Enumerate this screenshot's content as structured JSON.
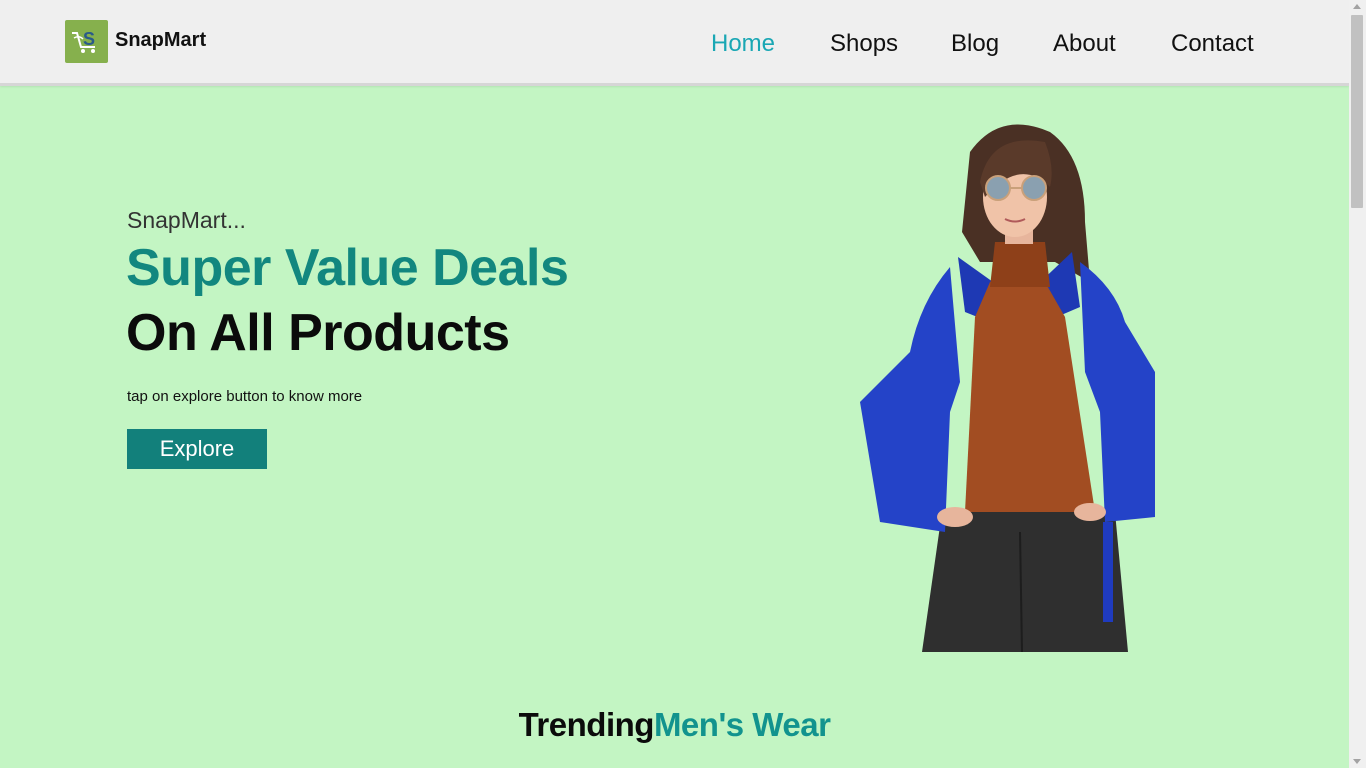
{
  "brand": {
    "name": "SnapMart",
    "logo_icon": "shopping-cart-s-logo"
  },
  "nav": {
    "items": [
      {
        "label": "Home",
        "active": true
      },
      {
        "label": "Shops",
        "active": false
      },
      {
        "label": "Blog",
        "active": false
      },
      {
        "label": "About",
        "active": false
      },
      {
        "label": "Contact",
        "active": false
      }
    ]
  },
  "hero": {
    "subtitle": "SnapMart...",
    "title_line1": "Super Value Deals",
    "title_line2": "On All Products",
    "description": "tap on explore button to know more",
    "button_label": "Explore",
    "image_alt": "woman in blue puffer jacket and rust sweater"
  },
  "section": {
    "title_part1": "Trending",
    "title_part2": "Men's Wear"
  },
  "colors": {
    "background": "#c3f5c3",
    "header": "#efefef",
    "accent_teal": "#12877f",
    "nav_active": "#1aa7b4",
    "logo_green": "#86b04d"
  }
}
